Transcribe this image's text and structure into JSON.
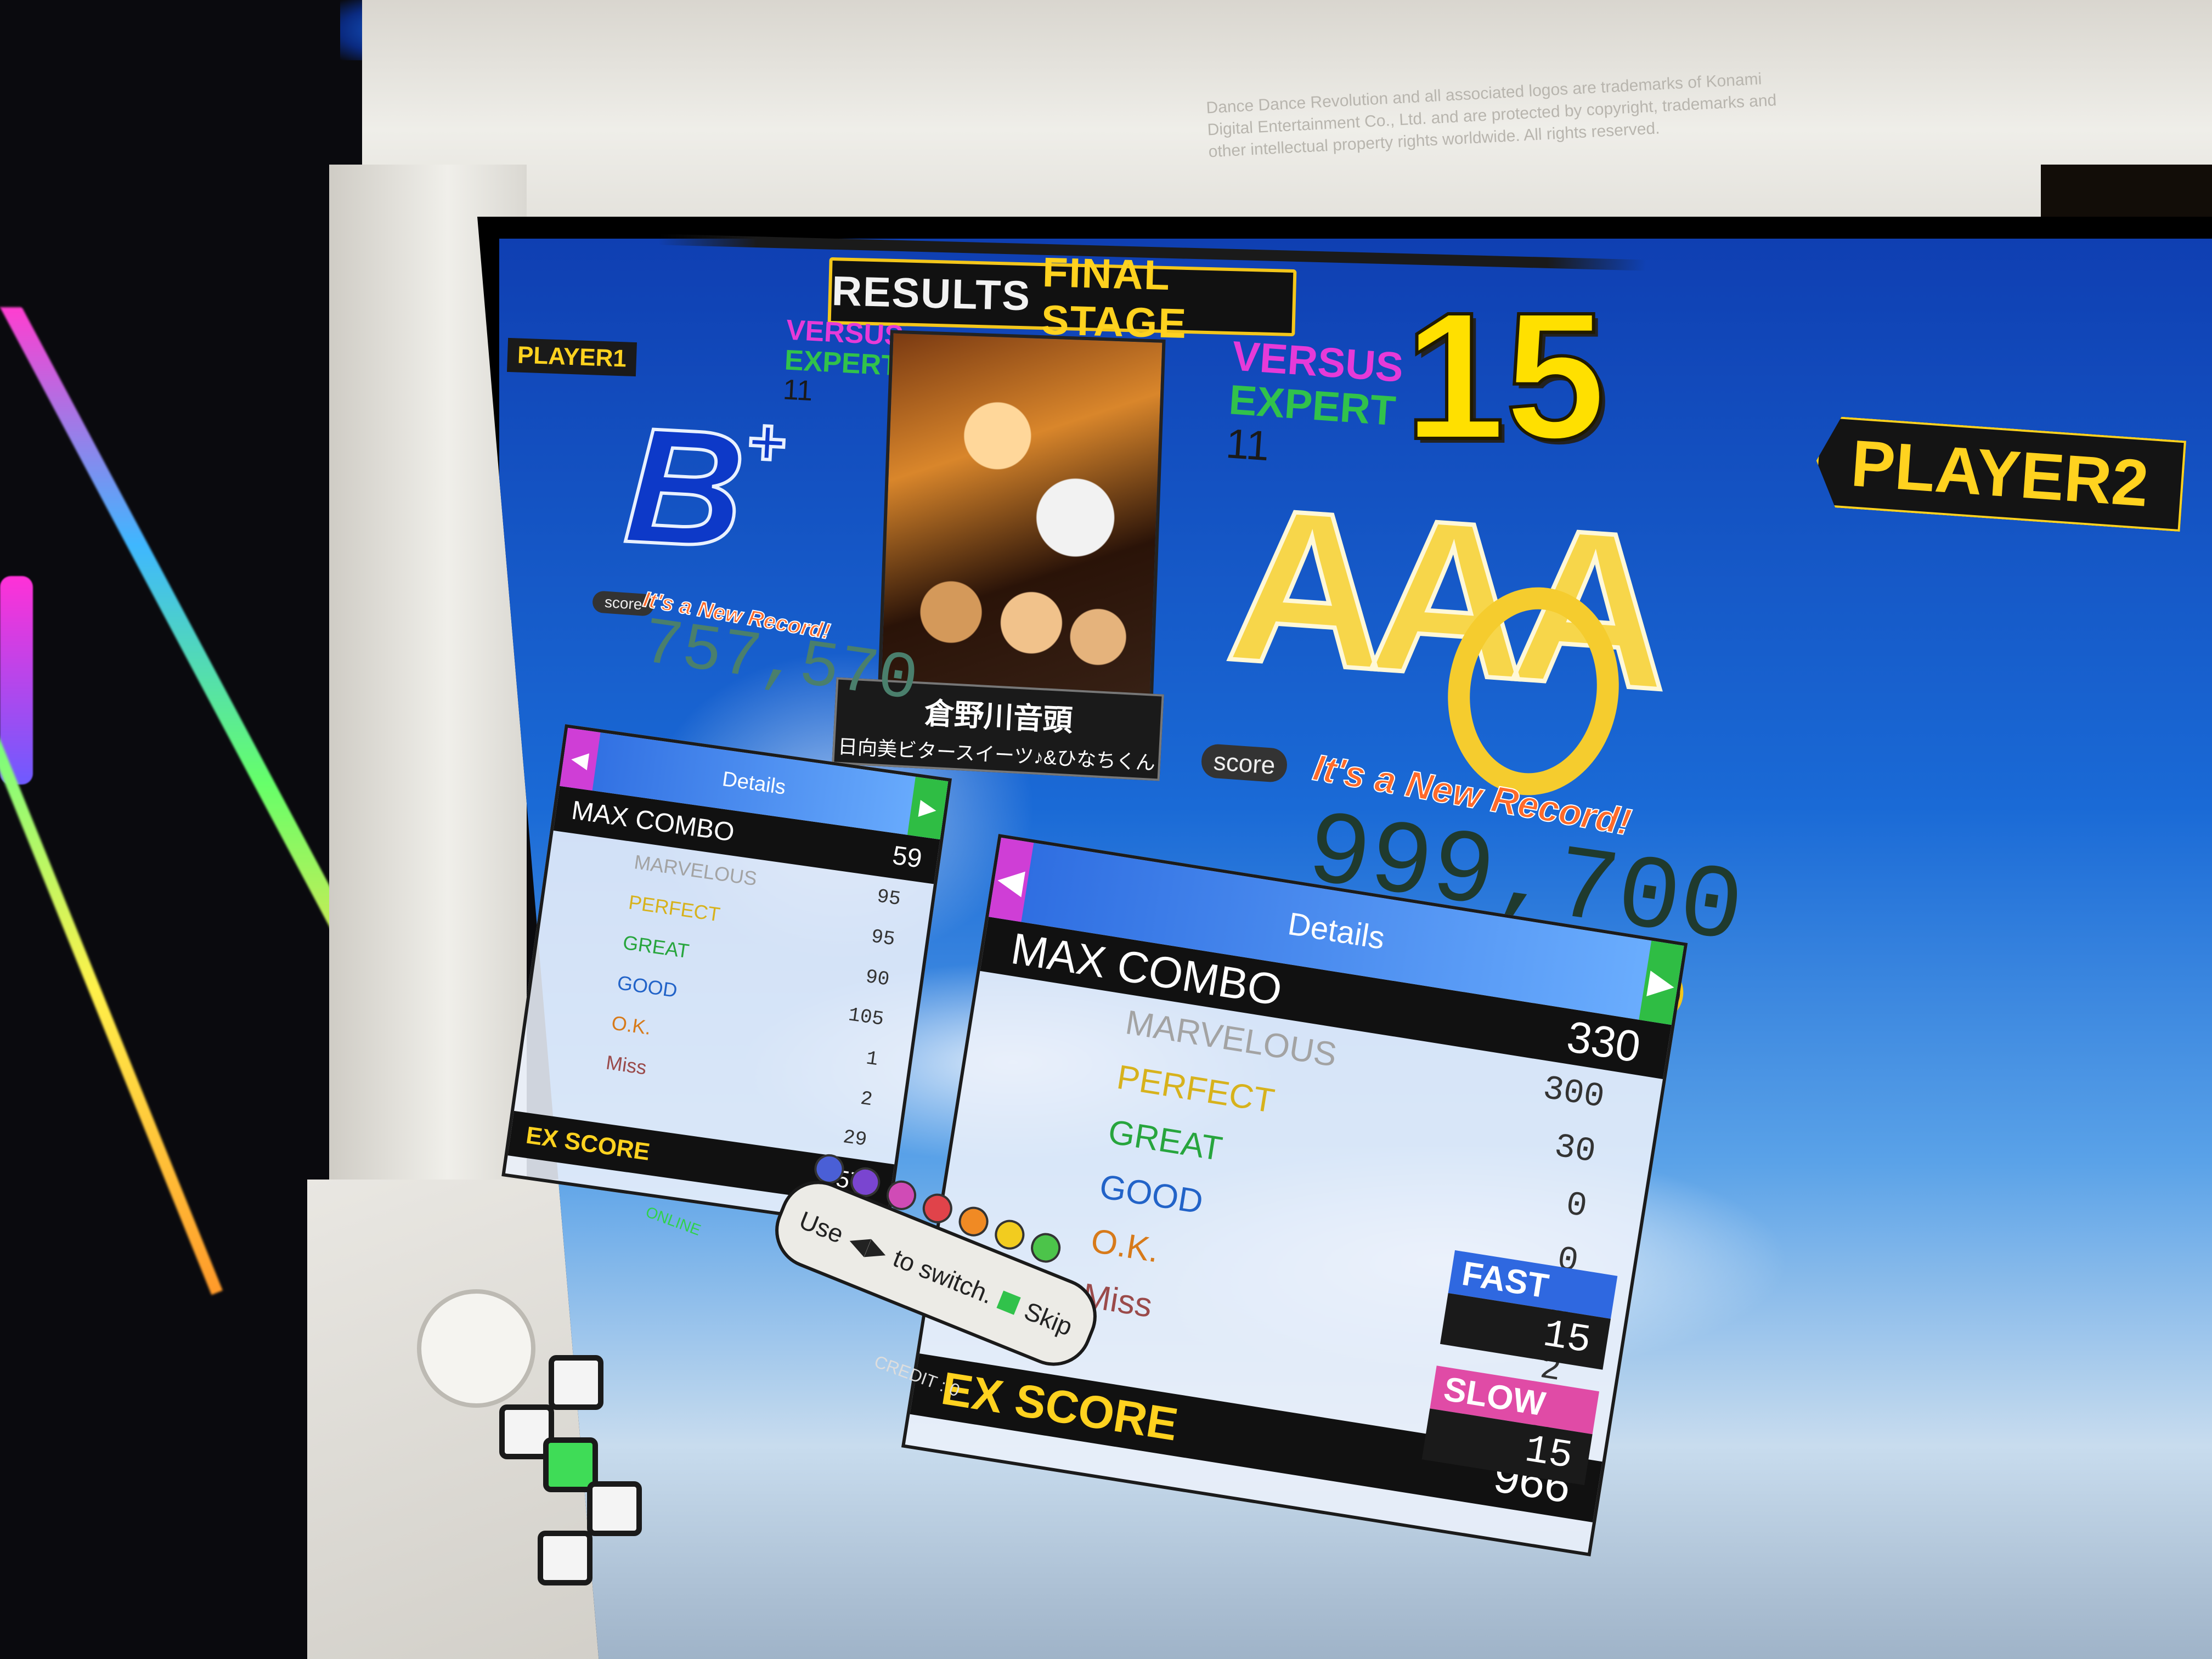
{
  "cabinet": {
    "legal_text": "Dance Dance Revolution and all associated logos are trademarks of Konami Digital Entertainment Co., Ltd. and are protected by copyright, trademarks and other intellectual property rights worldwide. All rights reserved."
  },
  "header": {
    "results_label": "RESULTS",
    "stage_label": "FINAL STAGE",
    "stage_number": "15",
    "player1_label": "PLAYER1",
    "player2_label": "PLAYER2"
  },
  "song": {
    "title": "倉野川音頭",
    "artist": "日向美ビタースイーツ♪&ひなちくん"
  },
  "player1": {
    "mode": "VERSUS",
    "difficulty": "EXPERT",
    "level": "11",
    "grade": "B",
    "grade_mod": "+",
    "score_label": "score",
    "new_record": "It's a New Record!",
    "score": "757,570",
    "details": {
      "tab_label": "Details",
      "tab_prev": "◀",
      "tab_next": "▶",
      "max_combo_label": "MAX COMBO",
      "max_combo": "59",
      "rows": [
        {
          "label": "MARVELOUS",
          "value": "95"
        },
        {
          "label": "PERFECT",
          "value": "95"
        },
        {
          "label": "GREAT",
          "value": "90"
        },
        {
          "label": "GOOD",
          "value": "105"
        },
        {
          "label": "O.K.",
          "value": "1"
        },
        {
          "label": "Miss",
          "value": "2"
        },
        {
          "label": "",
          "value": "29"
        }
      ],
      "ex_score_label": "EX SCORE",
      "ex_score": "576"
    }
  },
  "player2": {
    "mode": "VERSUS",
    "difficulty": "EXPERT",
    "level": "11",
    "grade": "AAA",
    "score_label": "score",
    "new_record": "It's a New Record!",
    "score": "999,700",
    "full_combo_lamps": 3,
    "details": {
      "tab_label": "Details",
      "tab_prev": "◀",
      "tab_next": "▶",
      "max_combo_label": "MAX COMBO",
      "max_combo": "330",
      "rows": [
        {
          "label": "MARVELOUS",
          "value": "300"
        },
        {
          "label": "PERFECT",
          "value": "30"
        },
        {
          "label": "GREAT",
          "value": "0"
        },
        {
          "label": "GOOD",
          "value": "0"
        },
        {
          "label": "O.K.",
          "value": "0"
        },
        {
          "label": "Miss",
          "value": "2"
        },
        {
          "label": "",
          "value": "0"
        }
      ],
      "ex_score_label": "EX SCORE",
      "ex_score": "966"
    },
    "fast_label": "FAST",
    "fast_value": "15",
    "slow_label": "SLOW",
    "slow_value": "15"
  },
  "footer": {
    "use_text": "Use",
    "switch_text": "to switch.",
    "skip_text": "Skip",
    "credit_text": "CREDIT : 0",
    "online_text": "ONLINE"
  },
  "colors": {
    "gold": "#ffd21f",
    "versus": "#e63ad8",
    "expert": "#31c24b",
    "fast": "#2f68e0",
    "slow": "#e04ba6"
  }
}
